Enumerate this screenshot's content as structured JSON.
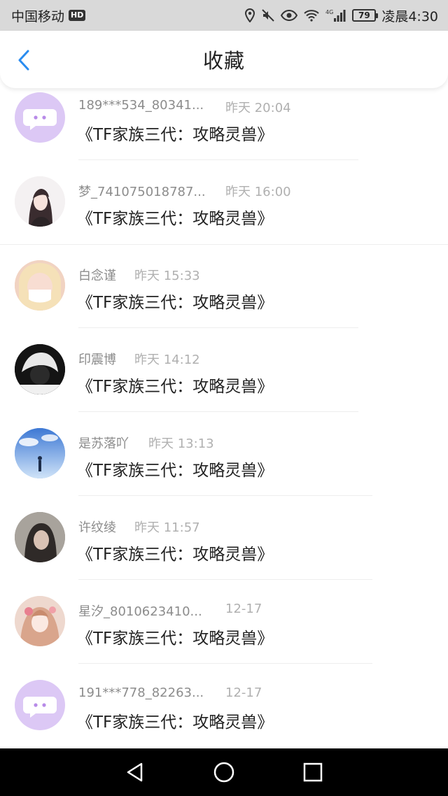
{
  "status_bar": {
    "carrier": "中国移动",
    "hd_badge": "HD",
    "network_label": "4G",
    "battery": "79",
    "time": "凌晨4:30"
  },
  "header": {
    "title": "收藏",
    "back_icon": "chevron-left-icon"
  },
  "colors": {
    "accent": "#2a8cf0",
    "default_avatar_bg": "#dcc8f5",
    "default_avatar_bubble": "#b88be8"
  },
  "items": [
    {
      "name": "189***534_80341...",
      "time": "昨天 20:04",
      "title": "《TF家族三代：攻略灵兽》",
      "avatar": "default-chat-avatar"
    },
    {
      "name": "梦_741075018787...",
      "time": "昨天 16:00",
      "title": "《TF家族三代：攻略灵兽》",
      "avatar": "anime-girl-avatar"
    },
    {
      "name": "白念谨",
      "time": "昨天 15:33",
      "title": "《TF家族三代：攻略灵兽》",
      "avatar": "photo-avatar"
    },
    {
      "name": "印震博",
      "time": "昨天 14:12",
      "title": "《TF家族三代：攻略灵兽》",
      "avatar": "dark-photo-avatar"
    },
    {
      "name": "是苏落吖",
      "time": "昨天 13:13",
      "title": "《TF家族三代：攻略灵兽》",
      "avatar": "sky-photo-avatar"
    },
    {
      "name": "许纹绫",
      "time": "昨天 11:57",
      "title": "《TF家族三代：攻略灵兽》",
      "avatar": "photo-avatar"
    },
    {
      "name": "星汐_8010623410...",
      "time": "12-17",
      "title": "《TF家族三代：攻略灵兽》",
      "avatar": "anime-girl-avatar"
    },
    {
      "name": "191***778_82263...",
      "time": "12-17",
      "title": "《TF家族三代：攻略灵兽》",
      "avatar": "default-chat-avatar"
    }
  ],
  "nav_bar": {
    "back": "triangle-back-icon",
    "home": "circle-home-icon",
    "recents": "square-recents-icon"
  }
}
